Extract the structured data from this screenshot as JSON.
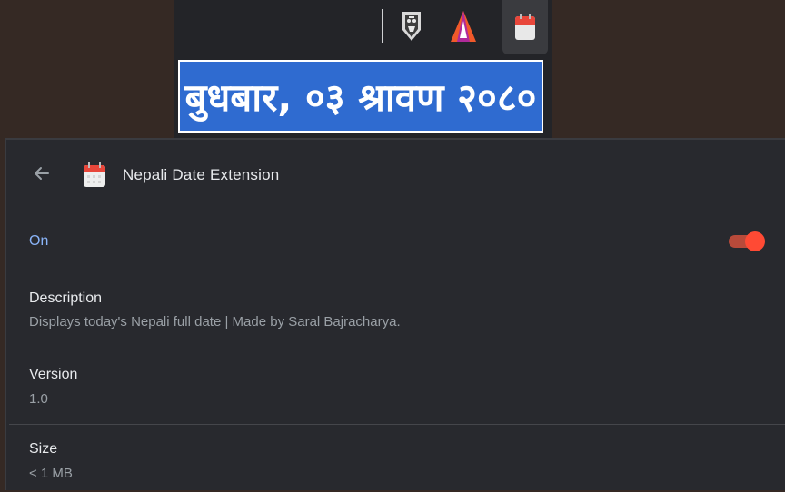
{
  "popup": {
    "date_text": "बुधबार, ०३ श्रावण २०८०",
    "background_color": "#2f6bd0"
  },
  "toolbar": {
    "icons": [
      "lion-shield-extension-icon",
      "triangle-extension-icon",
      "calendar-extension-icon"
    ]
  },
  "header": {
    "title": "Nepali Date Extension",
    "back_icon": "arrow-left-icon",
    "extension_icon": "calendar-icon"
  },
  "status": {
    "label": "On",
    "enabled": true,
    "accent_color": "#8ab4f8",
    "toggle_color": "#ff4a34"
  },
  "details": {
    "description_label": "Description",
    "description_value": "Displays today's Nepali full date | Made by Saral Bajracharya.",
    "version_label": "Version",
    "version_value": "1.0",
    "size_label": "Size",
    "size_value": "< 1 MB"
  }
}
